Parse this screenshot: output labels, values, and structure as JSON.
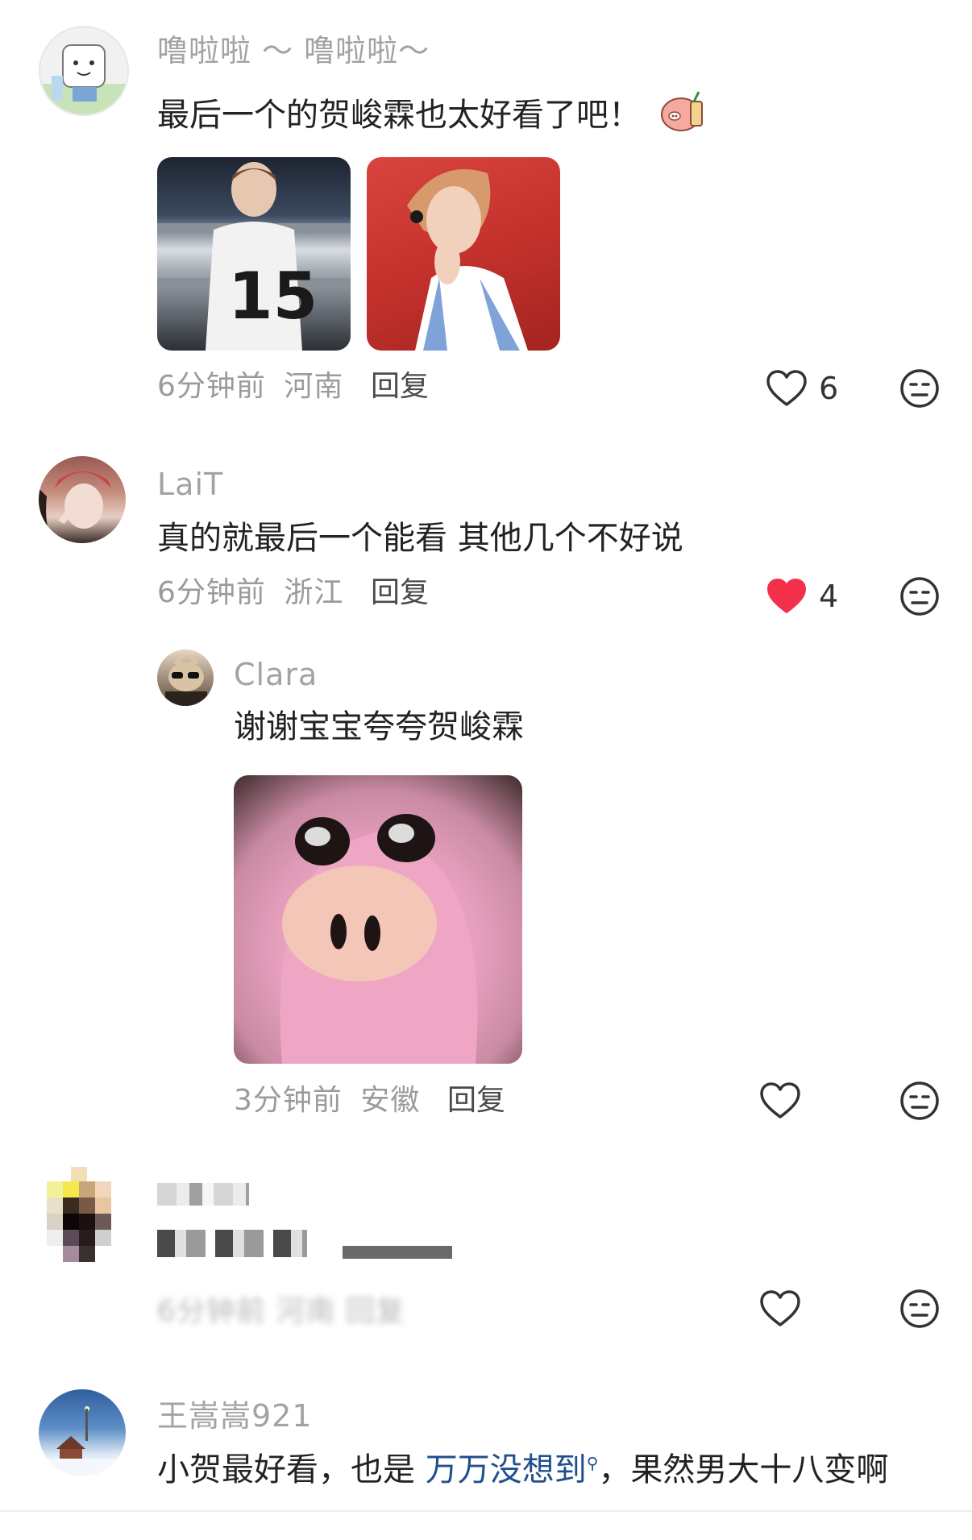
{
  "comments": [
    {
      "username": "噜啦啦 ～ 噜啦啦～",
      "text": "最后一个的贺峻霖也太好看了吧！",
      "sticker_icon": "pig-drink-sticker-icon",
      "images": [
        "concert-photo-1",
        "concert-photo-2"
      ],
      "time": "6分钟前",
      "location": "河南",
      "reply_label": "回复",
      "likes": "6",
      "liked": false
    },
    {
      "username": "LaiT",
      "text": "真的就最后一个能看 其他几个不好说",
      "time": "6分钟前",
      "location": "浙江",
      "reply_label": "回复",
      "likes": "4",
      "liked": true,
      "reply": {
        "username": "Clara",
        "text": "谢谢宝宝夸夸贺峻霖",
        "image": "pink-pig-photo",
        "time": "3分钟前",
        "location": "安徽",
        "reply_label": "回复"
      }
    },
    {
      "username": "",
      "text": "",
      "time_pixelated": "6分钟前 河南 回复",
      "blurred": true
    },
    {
      "username": "王嵩嵩921",
      "text_before": "小贺最好看，也是 ",
      "link_text": "万万没想到",
      "link_icon": "search-icon",
      "text_after": "，果然男大十八变啊"
    }
  ],
  "colors": {
    "like_red": "#f23049",
    "meta_gray": "#9b9b9b",
    "link_blue": "#1f4f8f"
  }
}
